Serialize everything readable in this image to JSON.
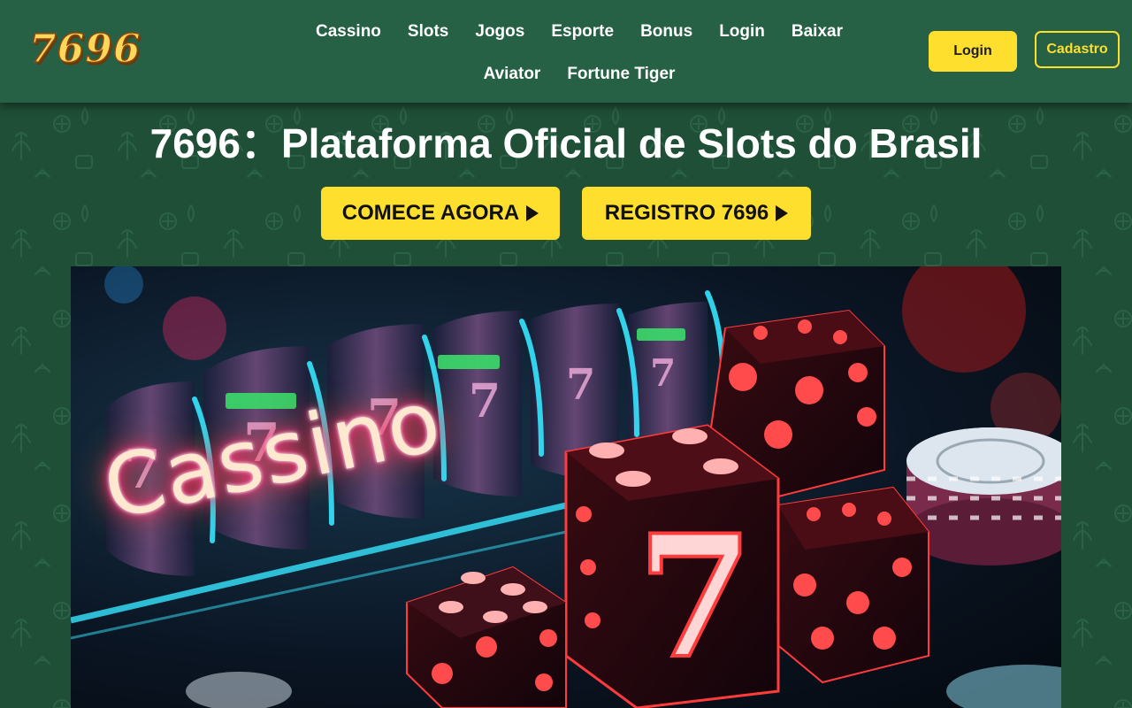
{
  "brand": {
    "logo_text": "7696",
    "colors": {
      "header_bg": "#266045",
      "page_bg": "#1f4f37",
      "accent_yellow": "#ffdf2e",
      "text_white": "#ffffff"
    }
  },
  "nav": {
    "items": [
      {
        "label": "Cassino"
      },
      {
        "label": "Slots"
      },
      {
        "label": "Jogos"
      },
      {
        "label": "Esporte"
      },
      {
        "label": "Bonus"
      },
      {
        "label": "Login"
      },
      {
        "label": "Baixar"
      },
      {
        "label": "Aviator"
      },
      {
        "label": "Fortune Tiger"
      }
    ]
  },
  "auth": {
    "login_label": "Login",
    "register_label": "Cadastro"
  },
  "hero": {
    "title": "7696：Plataforma Oficial de Slots do Brasil",
    "cta_start": "COMECE AGORA",
    "cta_register": "REGISTRO 7696",
    "cta_icon": "play-arrow-icon"
  },
  "banner": {
    "neon_text": "Cassino",
    "dice_face": "7"
  }
}
